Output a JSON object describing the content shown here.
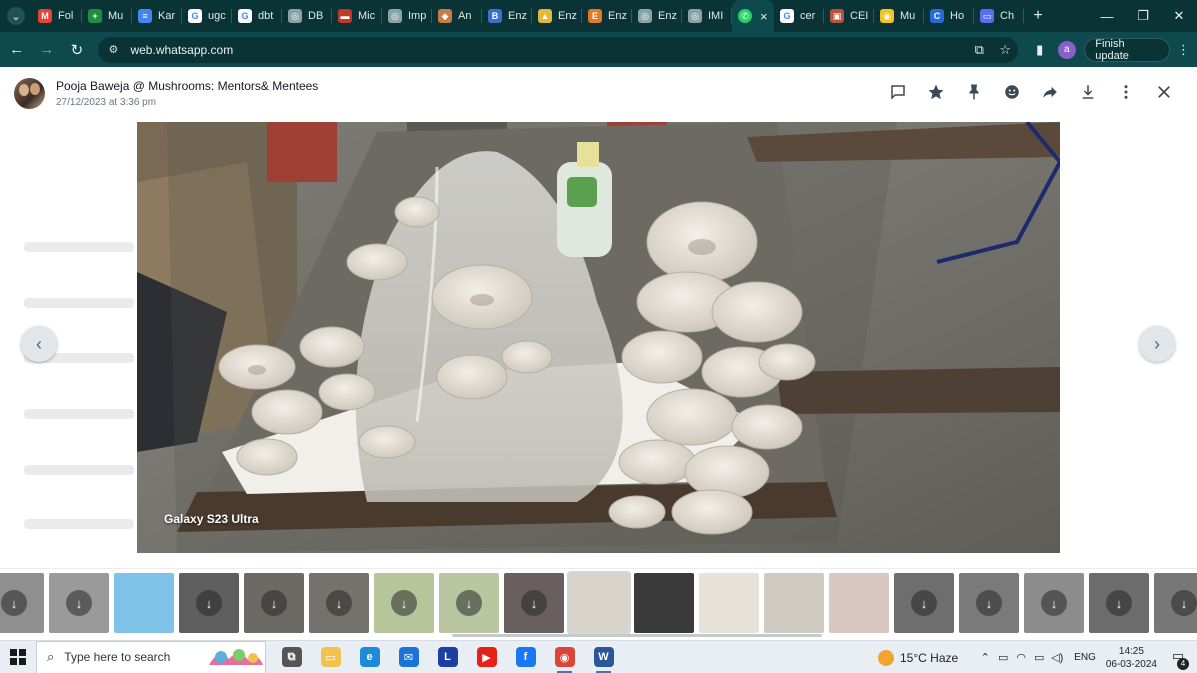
{
  "browser": {
    "tabs": [
      {
        "label": "Fol",
        "icon": "gmail-icon",
        "color": "#ea4335",
        "glyph": "M"
      },
      {
        "label": "Mu",
        "icon": "sheets-icon",
        "color": "#1e8e3e",
        "glyph": "+"
      },
      {
        "label": "Kar",
        "icon": "docs-icon",
        "color": "#4285f4",
        "glyph": "≡"
      },
      {
        "label": "ugc",
        "icon": "google-icon",
        "color": "#ffffff",
        "glyph": "G"
      },
      {
        "label": "dbt",
        "icon": "google-icon",
        "color": "#ffffff",
        "glyph": "G"
      },
      {
        "label": "DB",
        "icon": "globe-icon",
        "color": "#8aa3a4",
        "glyph": "◎"
      },
      {
        "label": "Mic",
        "icon": "flag-icon",
        "color": "#c0392b",
        "glyph": "▬"
      },
      {
        "label": "Imp",
        "icon": "globe-icon",
        "color": "#8aa3a4",
        "glyph": "◎"
      },
      {
        "label": "An",
        "icon": "site-icon",
        "color": "#c97b45",
        "glyph": "◆"
      },
      {
        "label": "Enz",
        "icon": "site-icon",
        "color": "#3a6fd0",
        "glyph": "B"
      },
      {
        "label": "Enz",
        "icon": "site-icon",
        "color": "#e2b93b",
        "glyph": "▲"
      },
      {
        "label": "Enz",
        "icon": "site-icon",
        "color": "#e07b28",
        "glyph": "E"
      },
      {
        "label": "Enz",
        "icon": "globe-icon",
        "color": "#8aa3a4",
        "glyph": "◎"
      },
      {
        "label": "IMI",
        "icon": "globe-icon",
        "color": "#8aa3a4",
        "glyph": "◎"
      }
    ],
    "active_tab": {
      "icon": "whatsapp-icon",
      "close": "×"
    },
    "tabs_after": [
      {
        "label": "cer",
        "icon": "google-icon",
        "color": "#ffffff",
        "glyph": "G"
      },
      {
        "label": "CEI",
        "icon": "site-icon",
        "color": "#b5533c",
        "glyph": "▣"
      },
      {
        "label": "Mu",
        "icon": "chrome-icon",
        "color": "#f3c324",
        "glyph": "◉"
      },
      {
        "label": "Ho",
        "icon": "site-icon",
        "color": "#2a6ad8",
        "glyph": "C"
      },
      {
        "label": "Ch",
        "icon": "site-icon",
        "color": "#5a6ff0",
        "glyph": "▭"
      }
    ],
    "new_tab": "+",
    "url": "web.whatsapp.com",
    "finish_update": "Finish update",
    "profile_initial": "a"
  },
  "viewer": {
    "sender_name": "Pooja Baweja @ Mushrooms: Mentors& Mentees",
    "timestamp": "27/12/2023 at 3:36 pm",
    "photo_caption": "Galaxy S23 Ultra",
    "prev": "‹",
    "next": "›"
  },
  "thumbnails": [
    {
      "kind": "download",
      "bg": "#8f8f8f"
    },
    {
      "kind": "download",
      "bg": "#9a9a9a"
    },
    {
      "kind": "image",
      "bg": "#7fc4e8"
    },
    {
      "kind": "download",
      "bg": "#5e5e5e"
    },
    {
      "kind": "download",
      "bg": "#6d6a66"
    },
    {
      "kind": "download",
      "bg": "#75716c"
    },
    {
      "kind": "download",
      "bg": "#b7c59b"
    },
    {
      "kind": "download",
      "bg": "#b9c6a0"
    },
    {
      "kind": "download",
      "bg": "#6a5f5f"
    },
    {
      "kind": "selected",
      "bg": "#d8d4cc"
    },
    {
      "kind": "image",
      "bg": "#3a3a3a"
    },
    {
      "kind": "image",
      "bg": "#e7e2d8"
    },
    {
      "kind": "image",
      "bg": "#cfcbc3"
    },
    {
      "kind": "image",
      "bg": "#d9c7c4"
    },
    {
      "kind": "download",
      "bg": "#6e6e6e"
    },
    {
      "kind": "download",
      "bg": "#7a7a7a"
    },
    {
      "kind": "download",
      "bg": "#8c8c8c"
    },
    {
      "kind": "download",
      "bg": "#6c6c6c"
    },
    {
      "kind": "download",
      "bg": "#777777"
    }
  ],
  "taskbar": {
    "search_placeholder": "Type here to search",
    "apps": [
      {
        "name": "task-view",
        "color": "#555555",
        "glyph": "⧉",
        "running": false
      },
      {
        "name": "file-explorer",
        "color": "#f2c14e",
        "glyph": "▭",
        "running": false
      },
      {
        "name": "edge",
        "color": "#1f8ad8",
        "glyph": "e",
        "running": false
      },
      {
        "name": "mail",
        "color": "#1a73d9",
        "glyph": "✉",
        "running": false
      },
      {
        "name": "launcher",
        "color": "#1d3fa3",
        "glyph": "L",
        "running": false
      },
      {
        "name": "youtube",
        "color": "#e62117",
        "glyph": "▶",
        "running": false
      },
      {
        "name": "facebook",
        "color": "#1877f2",
        "glyph": "f",
        "running": false
      },
      {
        "name": "chrome",
        "color": "#db4437",
        "glyph": "◉",
        "running": true
      },
      {
        "name": "word",
        "color": "#2b579a",
        "glyph": "W",
        "running": true
      }
    ],
    "weather": "15°C  Haze",
    "lang": "ENG",
    "time": "14:25",
    "date": "06-03-2024",
    "notif_count": "4"
  }
}
